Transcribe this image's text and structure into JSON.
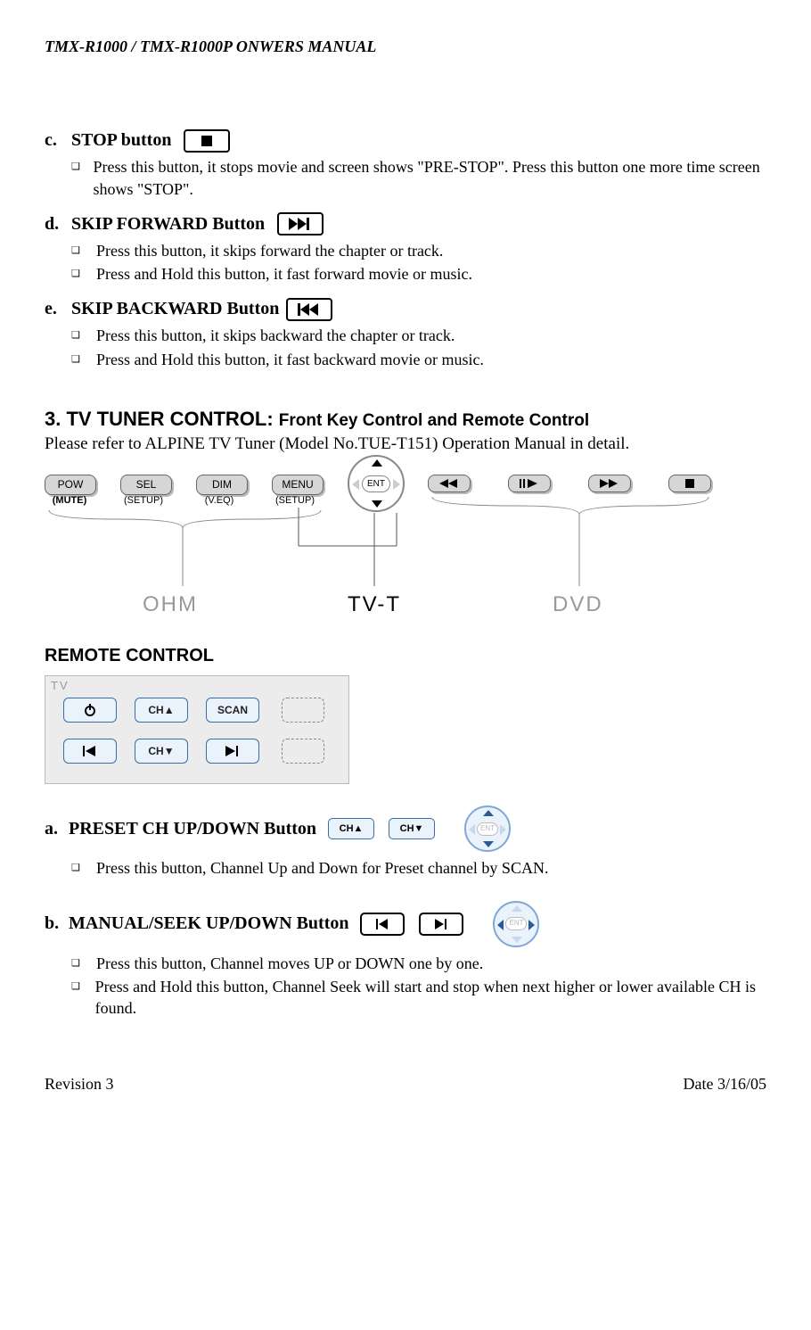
{
  "header": "TMX-R1000 / TMX-R1000P ONWERS MANUAL",
  "sec_c": {
    "lett": "c.",
    "title": "STOP button"
  },
  "c_b1": "Press this button, it stops movie and screen shows \"PRE-STOP\". Press this button one more time screen shows \"STOP\".",
  "sec_d": {
    "lett": "d.",
    "title": "SKIP FORWARD Button"
  },
  "d_b1": "Press this button, it skips forward the chapter or track.",
  "d_b2": "Press and Hold this button, it fast forward movie or music.",
  "sec_e": {
    "lett": "e.",
    "title": "SKIP BACKWARD Button"
  },
  "e_b1": "Press this button, it skips backward the chapter or track.",
  "e_b2": "Press and Hold this button, it fast backward movie or music.",
  "h2_num": "3. TV TUNER CONTROL:",
  "h2_sub": "Front Key Control and Remote Control",
  "h2_para": "Please refer to ALPINE TV Tuner (Model No.TUE-T151) Operation Manual in detail.",
  "ctrl": {
    "pow": "POW",
    "pow_u": "(MUTE)",
    "sel": "SEL",
    "sel_u": "(SETUP)",
    "dim": "DIM",
    "dim_u": "(V.EQ)",
    "menu": "MENU",
    "menu_u": "(SETUP)",
    "ent": "ENT",
    "ohm": "OHM",
    "tvt": "TV-T",
    "dvd": "DVD"
  },
  "h3": "REMOTE CONTROL",
  "remote": {
    "label": "TV",
    "chup": "CH▲",
    "scan": "SCAN",
    "chdn": "CH▼"
  },
  "sec_a": {
    "lett": "a.",
    "title": "PRESET CH UP/DOWN Button"
  },
  "a_chup": "CH▲",
  "a_chdn": "CH▼",
  "a_ent": "ENT",
  "a_b1": "Press this button, Channel Up and Down for Preset channel by SCAN.",
  "sec_b": {
    "lett": "b.",
    "title": "MANUAL/SEEK UP/DOWN Button"
  },
  "b_ent": "ENT",
  "b_b1": "Press this button, Channel moves UP or DOWN one by one.",
  "b_b2": "Press and Hold this button, Channel Seek will start and stop when next higher or lower available CH is found.",
  "footer": {
    "left": "Revision 3",
    "right": "Date 3/16/05"
  }
}
